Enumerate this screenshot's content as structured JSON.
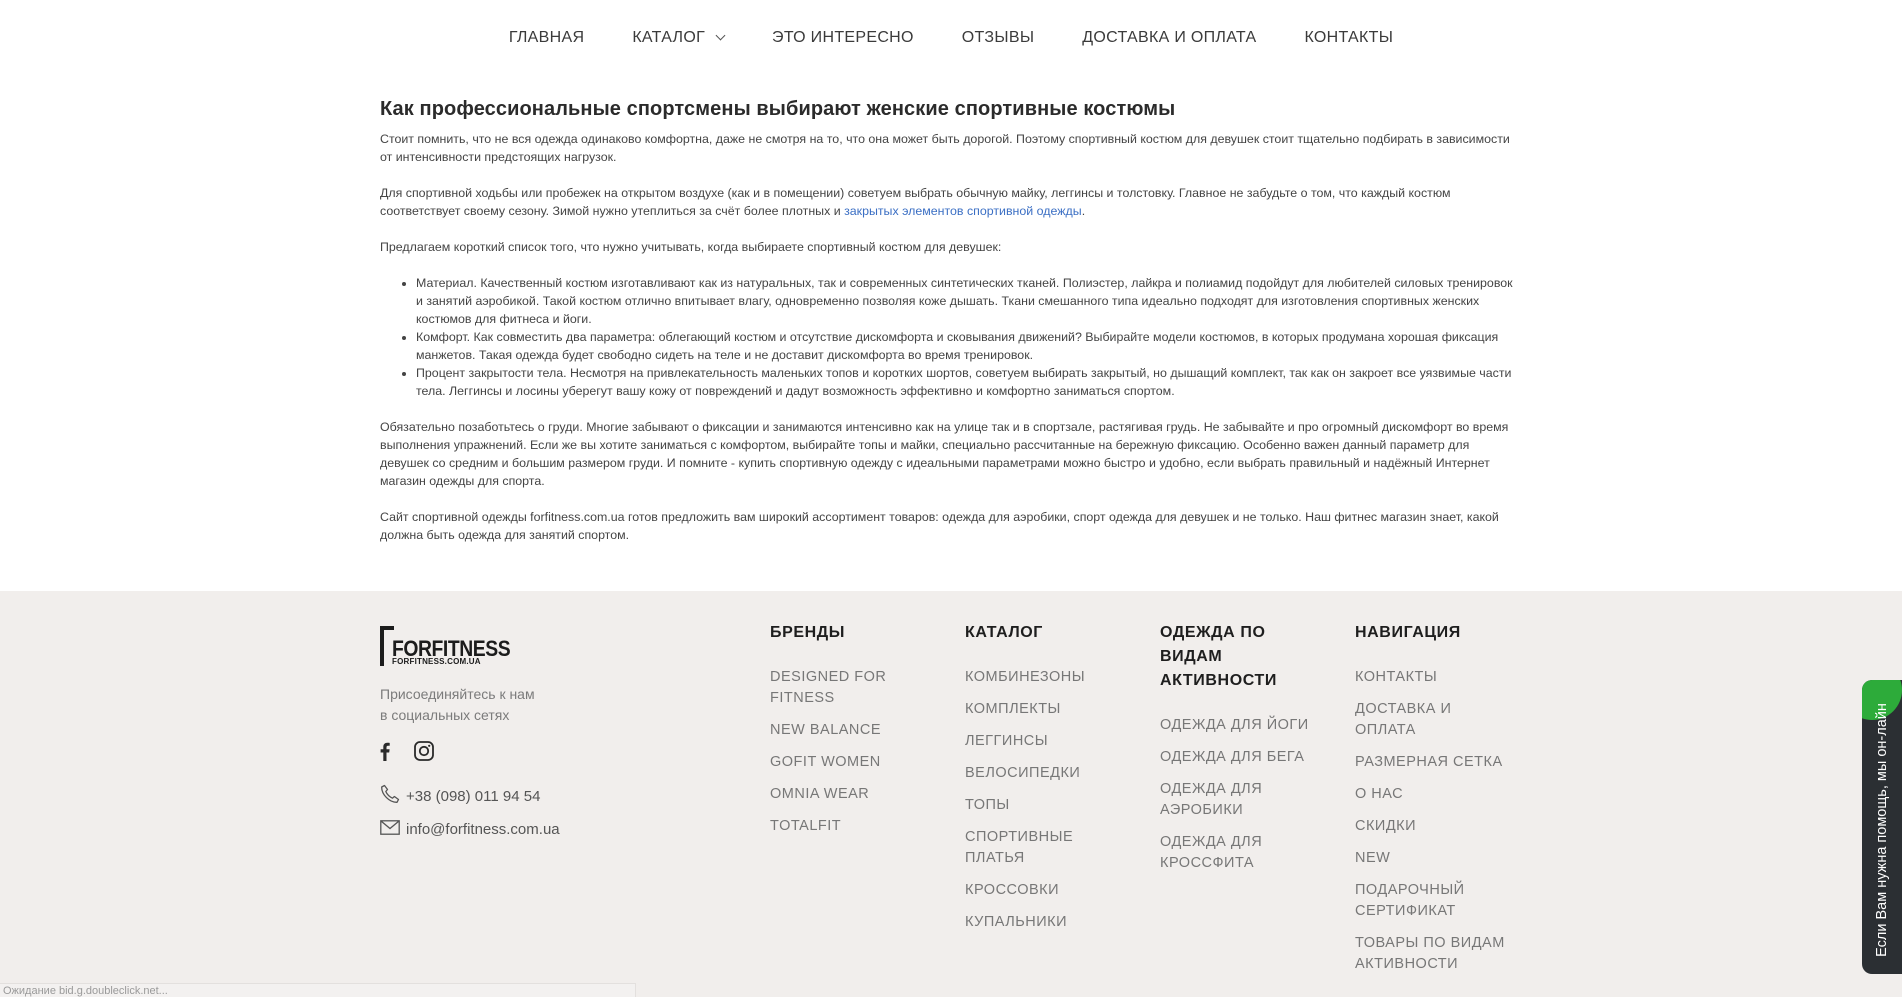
{
  "nav": {
    "items": [
      {
        "label": "ГЛАВНАЯ"
      },
      {
        "label": "КАТАЛОГ"
      },
      {
        "label": "ЭТО ИНТЕРЕСНО"
      },
      {
        "label": "ОТЗЫВЫ"
      },
      {
        "label": "ДОСТАВКА И ОПЛАТА"
      },
      {
        "label": "КОНТАКТЫ"
      }
    ]
  },
  "article": {
    "heading": "Как профессиональные спортсмены выбирают женские спортивные костюмы",
    "p1": "Стоит помнить, что не вся одежда одинаково комфортна, даже не смотря на то, что она может быть дорогой. Поэтому спортивный костюм для девушек стоит тщательно подбирать в зависимости от интенсивности предстоящих нагрузок.",
    "p2_text": "Для спортивной ходьбы или пробежек на открытом воздухе (как и в помещении) советуем выбрать обычную майку, леггинсы и толстовку. Главное не забудьте о том, что каждый костюм соответствует своему сезону. Зимой нужно утеплиться за счёт более плотных и ",
    "p2_link": "закрытых элементов спортивной одежды",
    "p2_end": ".",
    "p3": "Предлагаем короткий список того, что нужно учитывать, когда выбираете спортивный костюм для девушек:",
    "list": [
      "Материал. Качественный костюм изготавливают как из натуральных, так и современных синтетических тканей. Полиэстер, лайкра и полиамид подойдут для любителей силовых тренировок и занятий аэробикой. Такой костюм отлично впитывает влагу, одновременно позволяя коже дышать. Ткани смешанного типа идеально подходят для изготовления спортивных женских костюмов для фитнеса и йоги.",
      "Комфорт. Как совместить два параметра: облегающий костюм и отсутствие дискомфорта и сковывания движений? Выбирайте модели костюмов, в которых продумана хорошая фиксация манжетов. Такая одежда будет свободно сидеть на теле и не доставит дискомфорта во время тренировок.",
      "Процент закрытости тела. Несмотря на привлекательность маленьких топов и коротких шортов, советуем выбирать закрытый, но дышащий комплект, так как он закроет все уязвимые части тела. Леггинсы и лосины уберегут вашу кожу от повреждений и дадут возможность эффективно и комфортно заниматься спортом."
    ],
    "p4": "Обязательно позаботьтесь о груди. Многие забывают о фиксации и занимаются интенсивно как на улице так и в спортзале, растягивая грудь. Не забывайте и про огромный дискомфорт во время выполнения упражнений. Если же вы хотите заниматься с комфортом, выбирайте топы и майки, специально рассчитанные на бережную фиксацию. Особенно важен данный параметр для девушек со средним и большим размером груди. И помните - купить спортивную одежду с идеальными параметрами можно быстро и удобно, если выбрать правильный и надёжный Интернет магазин одежды для спорта.",
    "p5": "Сайт спортивной одежды forfitness.com.ua готов предложить вам широкий ассортимент товаров: одежда для аэробики, спорт одежда для девушек и не только. Наш фитнес магазин знает, какой должна быть одежда для занятий спортом."
  },
  "footer": {
    "logo_main": "FORFITNESS",
    "logo_sub": "FORFITNESS.COM.UA",
    "join_line1": "Присоединяйтесь к нам",
    "join_line2": "в социальных сетях",
    "phone": "+38 (098) 011 94 54",
    "email": "info@forfitness.com.ua",
    "brands": {
      "title": "БРЕНДЫ",
      "items": [
        "DESIGNED FOR FITNESS",
        "NEW BALANCE",
        "GOFIT WOMEN",
        "OMNIA WEAR",
        "TOTALFIT"
      ]
    },
    "catalog": {
      "title": "КАТАЛОГ",
      "items": [
        "КОМБИНЕЗОНЫ",
        "КОМПЛЕКТЫ",
        "ЛЕГГИНСЫ",
        "ВЕЛОСИПЕДКИ",
        "ТОПЫ",
        "СПОРТИВНЫЕ ПЛАТЬЯ",
        "КРОССОВКИ",
        "КУПАЛЬНИКИ"
      ]
    },
    "activity": {
      "title": "ОДЕЖДА ПО ВИДАМ АКТИВНОСТИ",
      "items": [
        "ОДЕЖДА ДЛЯ ЙОГИ",
        "ОДЕЖДА ДЛЯ БЕГА",
        "ОДЕЖДА ДЛЯ АЭРОБИКИ",
        "ОДЕЖДА ДЛЯ КРОССФИТА"
      ]
    },
    "navigation": {
      "title": "НАВИГАЦИЯ",
      "items": [
        "КОНТАКТЫ",
        "ДОСТАВКА И ОПЛАТА",
        "РАЗМЕРНАЯ СЕТКА",
        "О НАС",
        "СКИДКИ",
        "NEW",
        "ПОДАРОЧНЫЙ СЕРТИФИКАТ",
        "ТОВАРЫ ПО ВИДАМ АКТИВНОСТИ"
      ]
    }
  },
  "chat": {
    "label": "Если Вам нужна помощь, мы он-лайн"
  },
  "status": {
    "text": "Ожидание bid.g.doubleclick.net..."
  },
  "colors": {
    "link": "#3b6fc4",
    "footer_bg": "#f1eeec",
    "chat_bg": "#2b2f33",
    "chat_online": "#2dab3a"
  }
}
